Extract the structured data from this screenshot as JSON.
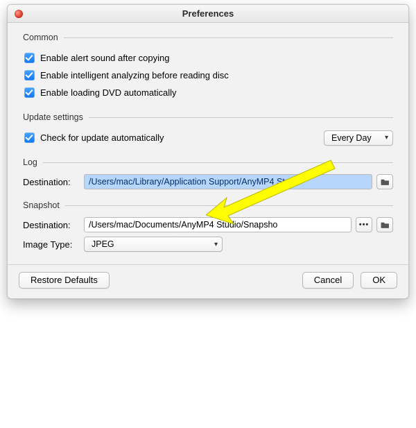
{
  "window": {
    "title": "Preferences"
  },
  "groups": {
    "common": {
      "legend": "Common",
      "opts": [
        "Enable alert sound after copying",
        "Enable intelligent analyzing before reading disc",
        "Enable loading DVD automatically"
      ]
    },
    "update": {
      "legend": "Update settings",
      "opt": "Check for update automatically",
      "interval_selected": "Every Day"
    },
    "log": {
      "legend": "Log",
      "dest_label": "Destination:",
      "dest_value": "/Users/mac/Library/Application Support/AnyMP4 Studi"
    },
    "snapshot": {
      "legend": "Snapshot",
      "dest_label": "Destination:",
      "dest_value": "/Users/mac/Documents/AnyMP4 Studio/Snapsho",
      "imgtype_label": "Image Type:",
      "imgtype_value": "JPEG"
    }
  },
  "footer": {
    "restore": "Restore Defaults",
    "cancel": "Cancel",
    "ok": "OK"
  },
  "colors": {
    "accent_checkbox": "#1076f0",
    "highlight_bg": "#b6d6fb",
    "arrow": "#fffd00"
  }
}
